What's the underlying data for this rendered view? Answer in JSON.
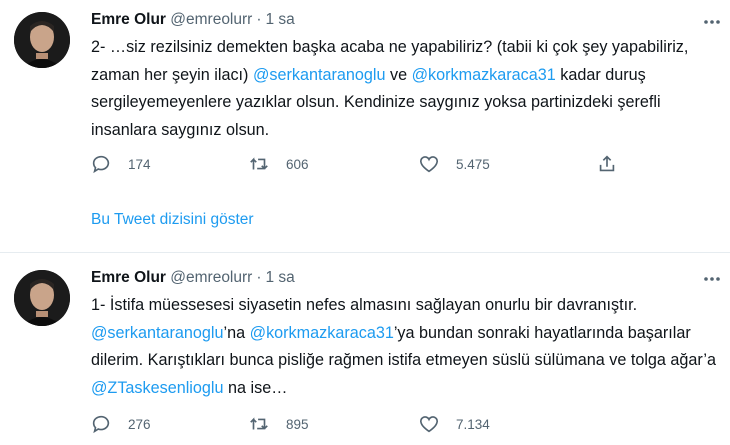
{
  "colors": {
    "accent": "#1d9bf0",
    "text": "#0f1419",
    "muted": "#536471",
    "divider": "#e6ecf0"
  },
  "tweets": [
    {
      "author": "Emre Olur",
      "handle": "@emreolurr",
      "time": "1 sa",
      "text_parts": [
        "2- …siz rezilsiniz demekten başka acaba ne yapabiliriz? (tabii ki çok şey yapabiliriz, zaman her şeyin ilacı) ",
        "@serkantaranoglu",
        " ve ",
        "@korkmazkaraca31",
        " kadar duruş sergileyemeyenlere yazıklar olsun. Kendinize saygınız yoksa partinizdeki şerefli insanlara saygınız olsun."
      ],
      "replies": "174",
      "retweets": "606",
      "likes": "5.475",
      "thread_link": "Bu Tweet dizisini göster"
    },
    {
      "author": "Emre Olur",
      "handle": "@emreolurr",
      "time": "1 sa",
      "text_parts": [
        "1- İstifa müessesesi siyasetin nefes almasını sağlayan onurlu bir davranıştır. ",
        "@serkantaranoglu",
        "’na ",
        "@korkmazkaraca31",
        "’ya bundan sonraki hayatlarında başarılar dilerim. Karıştıkları bunca pisliğe rağmen istifa etmeyen süslü sülümana ve tolga ağar’a ",
        "@ZTaskesenlioglu",
        " na ise…"
      ],
      "replies": "276",
      "retweets": "895",
      "likes": "7.134"
    }
  ],
  "icons": {
    "reply": "reply-icon",
    "retweet": "retweet-icon",
    "like": "heart-icon",
    "share": "share-icon",
    "more": "more-icon"
  }
}
